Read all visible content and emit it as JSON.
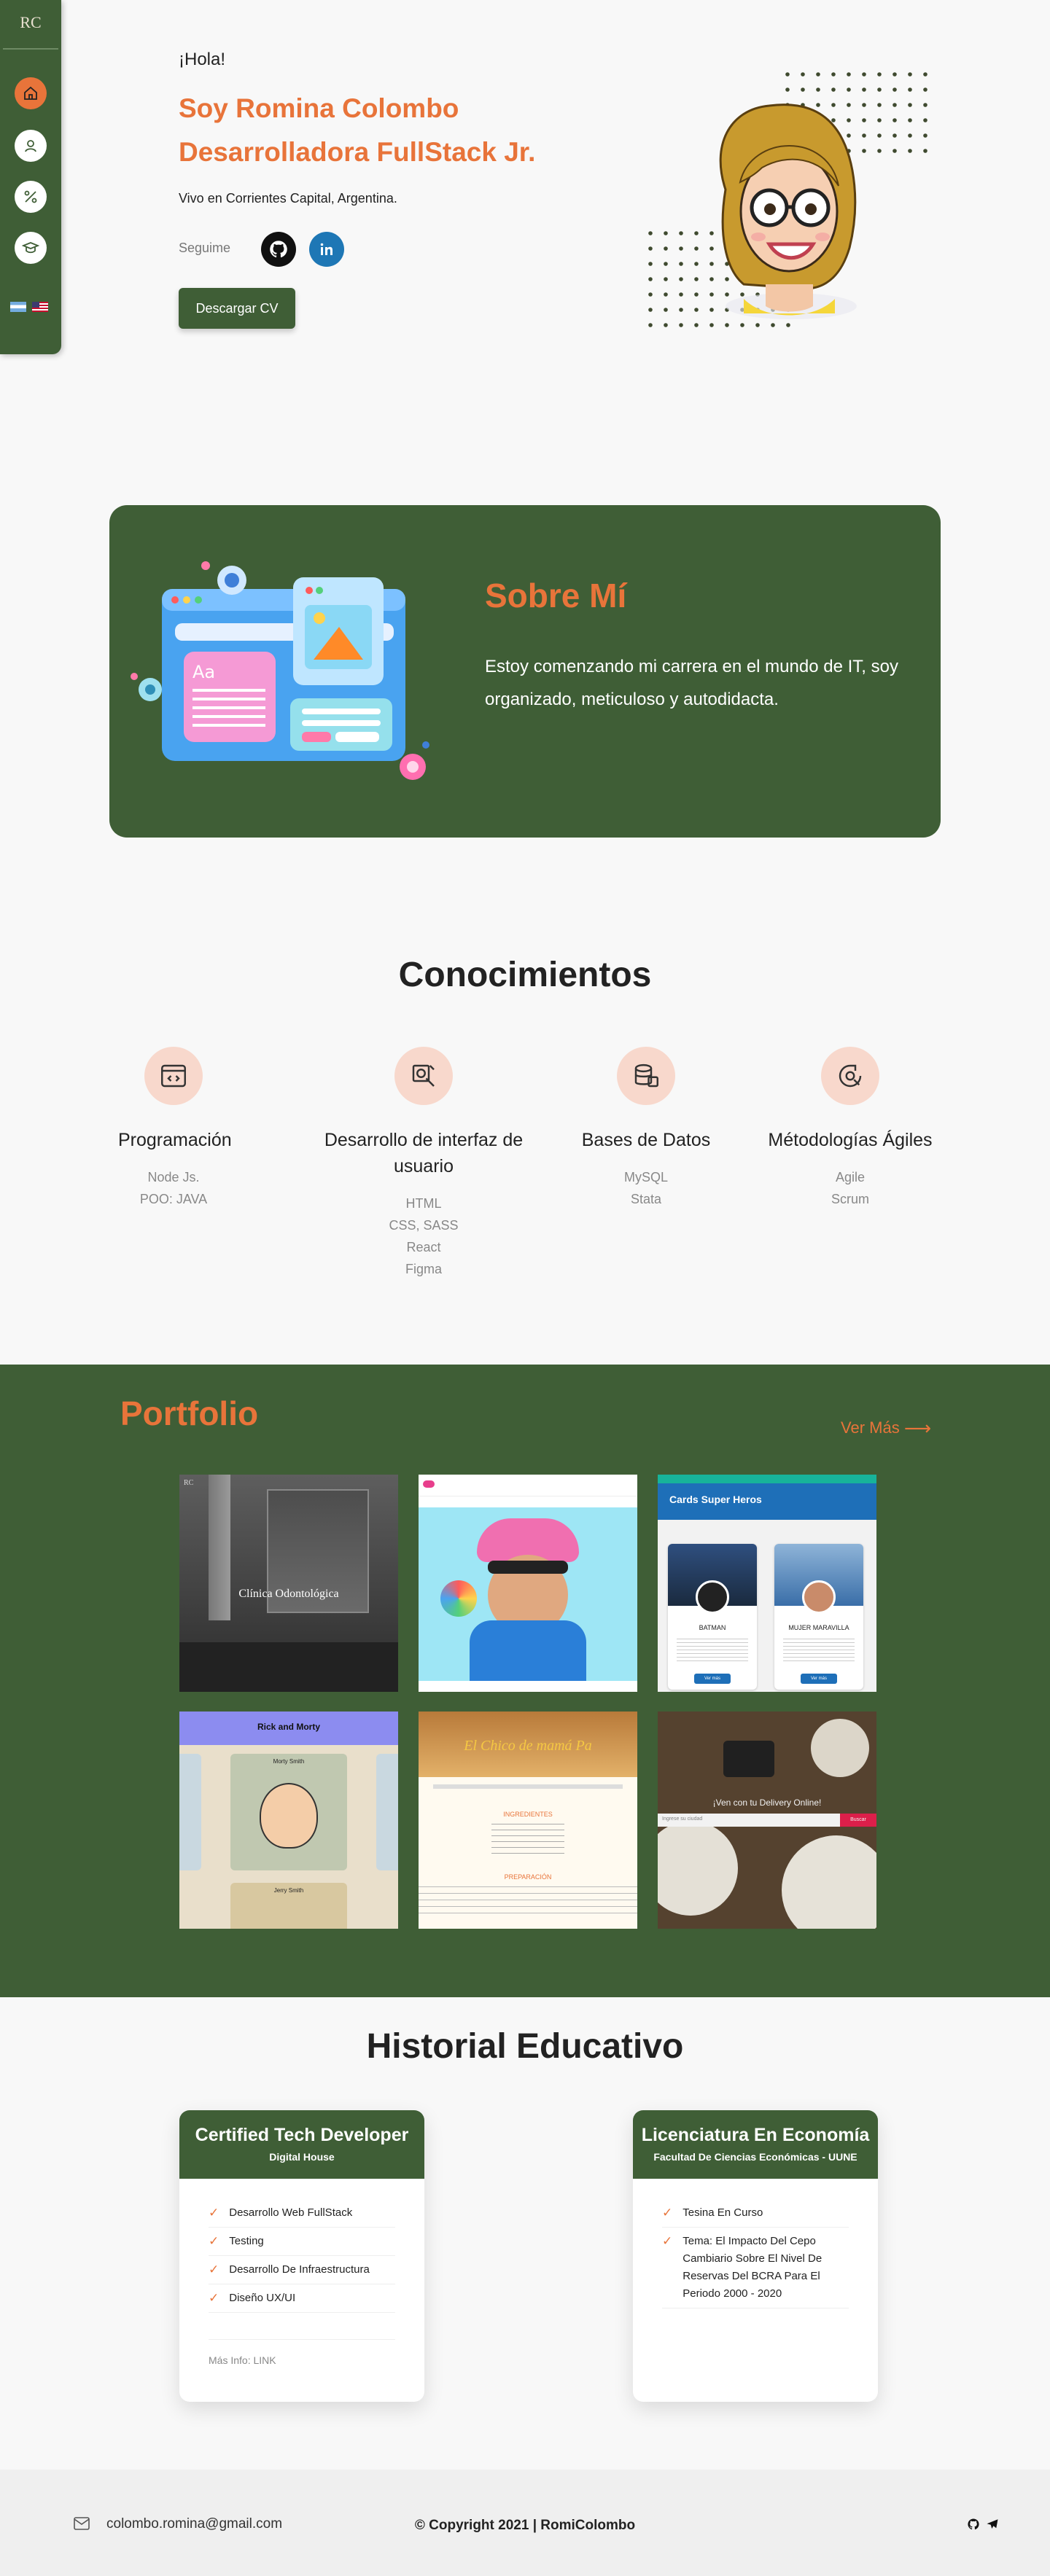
{
  "sidebar": {
    "logo": "RC",
    "items": [
      {
        "icon": "home-icon",
        "active": true
      },
      {
        "icon": "user-icon"
      },
      {
        "icon": "tools-icon"
      },
      {
        "icon": "graduation-icon"
      }
    ],
    "flags": [
      "argentina-flag",
      "usa-flag"
    ]
  },
  "hero": {
    "greeting": "¡Hola!",
    "name": "Soy Romina Colombo",
    "role": "Desarrolladora FullStack Jr.",
    "location": "Vivo en Corrientes Capital, Argentina.",
    "follow_label": "Seguime",
    "social": [
      "github-icon",
      "linkedin-icon"
    ],
    "cv_button": "Descargar CV",
    "avatar": "avatar-illustration"
  },
  "about": {
    "title": "Sobre Mí",
    "text": "Estoy comenzando mi carrera en el mundo de IT,  soy organizado, meticuloso y autodidacta."
  },
  "skills": {
    "title": "Conocimientos",
    "items": [
      {
        "icon": "code-window-icon",
        "name": "Programación",
        "list": [
          "Node Js.",
          "POO: JAVA"
        ]
      },
      {
        "icon": "design-icon",
        "name": "Desarrollo de interfaz de usuario",
        "list": [
          "HTML",
          "CSS, SASS",
          "React",
          "Figma"
        ]
      },
      {
        "icon": "database-icon",
        "name": "Bases de Datos",
        "list": [
          "MySQL",
          "Stata"
        ]
      },
      {
        "icon": "agile-icon",
        "name": "Métodologías Ágiles",
        "list": [
          "Agile",
          "Scrum"
        ]
      }
    ]
  },
  "portfolio": {
    "title": "Portfolio",
    "more": "Ver Más",
    "projects": [
      {
        "heading": "Clínica Odontológica",
        "logo": "RC"
      },
      {
        "heading": ""
      },
      {
        "heading": "Cards Super Heros",
        "cards": [
          "BATMAN",
          "MUJER MARAVILLA"
        ],
        "button": "Ver más"
      },
      {
        "heading": "Rick and Morty",
        "names": [
          "Morty Smith",
          "Jerry Smith"
        ]
      },
      {
        "heading": "El Chico de mamá Pa",
        "section_a": "INGREDIENTES",
        "section_b": "PREPARACIÓN"
      },
      {
        "heading": "¡Ven con tu Delivery Online!",
        "search_placeholder": "Ingrese su ciudad",
        "button": "Buscar"
      }
    ]
  },
  "education": {
    "title": "Historial Educativo",
    "cards": [
      {
        "title": "Certified Tech Developer",
        "subtitle": "Digital House",
        "items": [
          "Desarrollo Web FullStack",
          "Testing",
          "Desarrollo De Infraestructura",
          "Diseño UX/UI"
        ],
        "more": "Más Info: LINK"
      },
      {
        "title": "Licenciatura En Economía",
        "subtitle": "Facultad De Ciencias Económicas - UUNE",
        "items": [
          "Tesina En Curso",
          "Tema: El Impacto Del Cepo Cambiario Sobre El Nivel De Reservas Del BCRA Para El Periodo 2000 - 2020"
        ]
      }
    ]
  },
  "footer": {
    "email": "colombo.romina@gmail.com",
    "copyright": "© Copyright 2021 | RomiColombo",
    "social": [
      "github-icon",
      "telegram-icon"
    ]
  },
  "colors": {
    "accent": "#e8743a",
    "brand": "#3f5e36"
  }
}
